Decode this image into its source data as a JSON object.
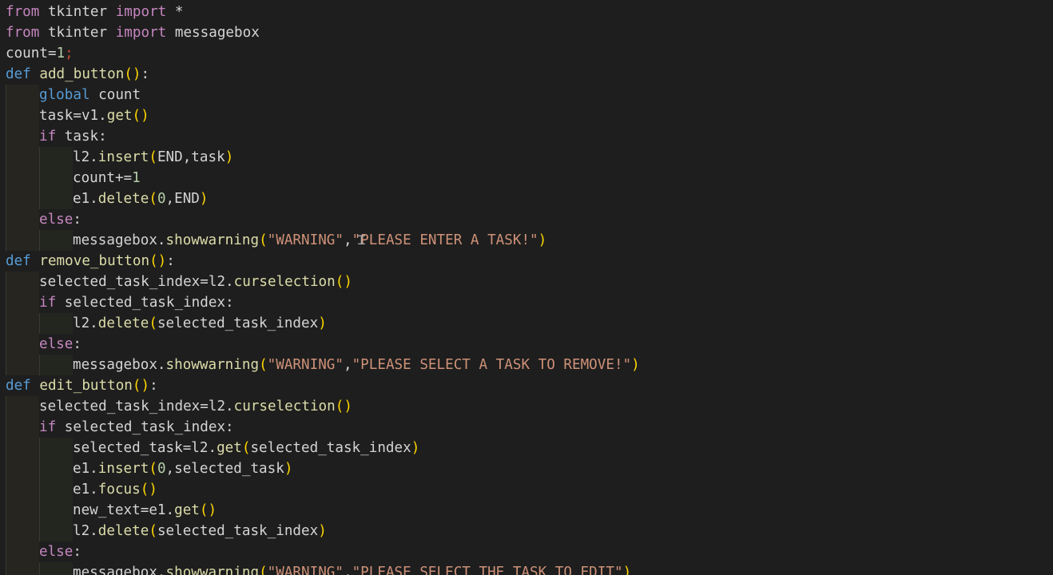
{
  "editor": {
    "theme": "dark",
    "background": "#1e1e1e",
    "language": "python",
    "lines": [
      {
        "indent": 0,
        "tokens": [
          {
            "t": "from",
            "c": "kw-import"
          },
          {
            "t": " tkinter ",
            "c": "plain"
          },
          {
            "t": "import",
            "c": "kw-import"
          },
          {
            "t": " *",
            "c": "plain"
          }
        ]
      },
      {
        "indent": 0,
        "tokens": [
          {
            "t": "from",
            "c": "kw-import"
          },
          {
            "t": " tkinter ",
            "c": "plain"
          },
          {
            "t": "import",
            "c": "kw-import"
          },
          {
            "t": " messagebox",
            "c": "plain"
          }
        ]
      },
      {
        "indent": 0,
        "tokens": [
          {
            "t": "count=",
            "c": "plain"
          },
          {
            "t": "1",
            "c": "num"
          },
          {
            "t": ";",
            "c": "semi"
          }
        ]
      },
      {
        "indent": 0,
        "tokens": [
          {
            "t": "def",
            "c": "kw-def"
          },
          {
            "t": " ",
            "c": "plain"
          },
          {
            "t": "add_button",
            "c": "fn"
          },
          {
            "t": "()",
            "c": "b1"
          },
          {
            "t": ":",
            "c": "plain"
          }
        ]
      },
      {
        "indent": 1,
        "tokens": [
          {
            "t": "global",
            "c": "kw-global"
          },
          {
            "t": " count",
            "c": "plain"
          }
        ]
      },
      {
        "indent": 1,
        "tokens": [
          {
            "t": "task=v1.",
            "c": "plain"
          },
          {
            "t": "get",
            "c": "fn"
          },
          {
            "t": "()",
            "c": "b1"
          }
        ]
      },
      {
        "indent": 1,
        "tokens": [
          {
            "t": "if",
            "c": "kw-ctrl"
          },
          {
            "t": " task:",
            "c": "plain"
          }
        ]
      },
      {
        "indent": 2,
        "tokens": [
          {
            "t": "l2.",
            "c": "plain"
          },
          {
            "t": "insert",
            "c": "fn"
          },
          {
            "t": "(",
            "c": "b1"
          },
          {
            "t": "END,task",
            "c": "plain"
          },
          {
            "t": ")",
            "c": "b1"
          }
        ]
      },
      {
        "indent": 2,
        "tokens": [
          {
            "t": "count+=",
            "c": "plain"
          },
          {
            "t": "1",
            "c": "num"
          }
        ]
      },
      {
        "indent": 2,
        "tokens": [
          {
            "t": "e1.",
            "c": "plain"
          },
          {
            "t": "delete",
            "c": "fn"
          },
          {
            "t": "(",
            "c": "b1"
          },
          {
            "t": "0",
            "c": "num"
          },
          {
            "t": ",END",
            "c": "plain"
          },
          {
            "t": ")",
            "c": "b1"
          }
        ]
      },
      {
        "indent": 1,
        "tokens": [
          {
            "t": "else",
            "c": "kw-ctrl"
          },
          {
            "t": ":",
            "c": "plain"
          }
        ]
      },
      {
        "indent": 2,
        "tokens": [
          {
            "t": "messagebox.",
            "c": "plain"
          },
          {
            "t": "showwarning",
            "c": "fn"
          },
          {
            "t": "(",
            "c": "b1"
          },
          {
            "t": "\"WARNING\"",
            "c": "str"
          },
          {
            "t": ",",
            "c": "plain"
          },
          {
            "t": "\"PLEASE ENTER A TASK!\"",
            "c": "str"
          },
          {
            "t": ")",
            "c": "b1"
          }
        ]
      },
      {
        "indent": 0,
        "tokens": [
          {
            "t": "def",
            "c": "kw-def"
          },
          {
            "t": " ",
            "c": "plain"
          },
          {
            "t": "remove_button",
            "c": "fn"
          },
          {
            "t": "()",
            "c": "b1"
          },
          {
            "t": ":",
            "c": "plain"
          }
        ]
      },
      {
        "indent": 1,
        "tokens": [
          {
            "t": "selected_task_index=l2.",
            "c": "plain"
          },
          {
            "t": "curselection",
            "c": "fn"
          },
          {
            "t": "()",
            "c": "b1"
          }
        ]
      },
      {
        "indent": 1,
        "tokens": [
          {
            "t": "if",
            "c": "kw-ctrl"
          },
          {
            "t": " selected_task_index:",
            "c": "plain"
          }
        ]
      },
      {
        "indent": 2,
        "tokens": [
          {
            "t": "l2.",
            "c": "plain"
          },
          {
            "t": "delete",
            "c": "fn"
          },
          {
            "t": "(",
            "c": "b1"
          },
          {
            "t": "selected_task_index",
            "c": "plain"
          },
          {
            "t": ")",
            "c": "b1"
          }
        ]
      },
      {
        "indent": 1,
        "tokens": [
          {
            "t": "else",
            "c": "kw-ctrl"
          },
          {
            "t": ":",
            "c": "plain"
          }
        ]
      },
      {
        "indent": 2,
        "tokens": [
          {
            "t": "messagebox.",
            "c": "plain"
          },
          {
            "t": "showwarning",
            "c": "fn"
          },
          {
            "t": "(",
            "c": "b1"
          },
          {
            "t": "\"WARNING\"",
            "c": "str"
          },
          {
            "t": ",",
            "c": "plain"
          },
          {
            "t": "\"PLEASE SELECT A TASK TO REMOVE!\"",
            "c": "str"
          },
          {
            "t": ")",
            "c": "b1"
          }
        ]
      },
      {
        "indent": 0,
        "tokens": [
          {
            "t": "def",
            "c": "kw-def"
          },
          {
            "t": " ",
            "c": "plain"
          },
          {
            "t": "edit_button",
            "c": "fn"
          },
          {
            "t": "()",
            "c": "b1"
          },
          {
            "t": ":",
            "c": "plain"
          }
        ]
      },
      {
        "indent": 1,
        "tokens": [
          {
            "t": "selected_task_index=l2.",
            "c": "plain"
          },
          {
            "t": "curselection",
            "c": "fn"
          },
          {
            "t": "()",
            "c": "b1"
          }
        ]
      },
      {
        "indent": 1,
        "tokens": [
          {
            "t": "if",
            "c": "kw-ctrl"
          },
          {
            "t": " selected_task_index:",
            "c": "plain"
          }
        ]
      },
      {
        "indent": 2,
        "tokens": [
          {
            "t": "selected_task=l2.",
            "c": "plain"
          },
          {
            "t": "get",
            "c": "fn"
          },
          {
            "t": "(",
            "c": "b1"
          },
          {
            "t": "selected_task_index",
            "c": "plain"
          },
          {
            "t": ")",
            "c": "b1"
          }
        ]
      },
      {
        "indent": 2,
        "tokens": [
          {
            "t": "e1.",
            "c": "plain"
          },
          {
            "t": "insert",
            "c": "fn"
          },
          {
            "t": "(",
            "c": "b1"
          },
          {
            "t": "0",
            "c": "num"
          },
          {
            "t": ",selected_task",
            "c": "plain"
          },
          {
            "t": ")",
            "c": "b1"
          }
        ]
      },
      {
        "indent": 2,
        "tokens": [
          {
            "t": "e1.",
            "c": "plain"
          },
          {
            "t": "focus",
            "c": "fn"
          },
          {
            "t": "()",
            "c": "b1"
          }
        ]
      },
      {
        "indent": 2,
        "tokens": [
          {
            "t": "new_text=e1.",
            "c": "plain"
          },
          {
            "t": "get",
            "c": "fn"
          },
          {
            "t": "()",
            "c": "b1"
          }
        ]
      },
      {
        "indent": 2,
        "tokens": [
          {
            "t": "l2.",
            "c": "plain"
          },
          {
            "t": "delete",
            "c": "fn"
          },
          {
            "t": "(",
            "c": "b1"
          },
          {
            "t": "selected_task_index",
            "c": "plain"
          },
          {
            "t": ")",
            "c": "b1"
          }
        ]
      },
      {
        "indent": 1,
        "tokens": [
          {
            "t": "else",
            "c": "kw-ctrl"
          },
          {
            "t": ":",
            "c": "plain"
          }
        ]
      },
      {
        "indent": 2,
        "tokens": [
          {
            "t": "messagebox.",
            "c": "plain"
          },
          {
            "t": "showwarning",
            "c": "fn"
          },
          {
            "t": "(",
            "c": "b1"
          },
          {
            "t": "\"WARNING\"",
            "c": "str"
          },
          {
            "t": ",",
            "c": "plain"
          },
          {
            "t": "\"PLEASE SELECT THE TASK TO EDIT\"",
            "c": "str"
          },
          {
            "t": ")",
            "c": "b1"
          }
        ]
      }
    ]
  },
  "mouse_cursor": {
    "icon": "text-ibeam-icon",
    "glyph": "Ɪ"
  }
}
